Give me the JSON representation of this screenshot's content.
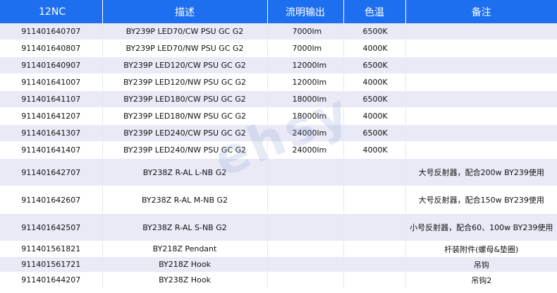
{
  "table": {
    "headers": [
      "12NC",
      "描述",
      "流明输出",
      "色温",
      "备注"
    ],
    "rows": [
      {
        "nc": "911401640707",
        "desc": "BY239P LED70/CW PSU GC G2",
        "flux": "7000lm",
        "cct": "6500K",
        "note": ""
      },
      {
        "nc": "911401640807",
        "desc": "BY239P LED70/NW PSU GC G2",
        "flux": "7000lm",
        "cct": "4000K",
        "note": ""
      },
      {
        "nc": "911401640907",
        "desc": "BY239P LED120/CW PSU GC G2",
        "flux": "12000lm",
        "cct": "6500K",
        "note": ""
      },
      {
        "nc": "911401641007",
        "desc": "BY239P LED120/NW PSU GC G2",
        "flux": "12000lm",
        "cct": "4000K",
        "note": ""
      },
      {
        "nc": "911401641107",
        "desc": "BY239P LED180/CW PSU GC G2",
        "flux": "18000lm",
        "cct": "6500K",
        "note": ""
      },
      {
        "nc": "911401641207",
        "desc": "BY239P LED180/NW PSU GC G2",
        "flux": "18000lm",
        "cct": "4000K",
        "note": ""
      },
      {
        "nc": "911401641307",
        "desc": "BY239P LED240/CW PSU GC G2",
        "flux": "24000lm",
        "cct": "6500K",
        "note": ""
      },
      {
        "nc": "911401641407",
        "desc": "BY239P LED240/NW PSU GC G2",
        "flux": "24000lm",
        "cct": "4000K",
        "note": ""
      },
      {
        "nc": "911401642707",
        "desc": "BY238Z R-AL L-NB G2",
        "flux": "",
        "cct": "",
        "note": "大号反射器，配合200w BY239使用"
      },
      {
        "nc": "911401642607",
        "desc": "BY238Z R-AL M-NB G2",
        "flux": "",
        "cct": "",
        "note": "大号反射器，配合150w BY239使用"
      },
      {
        "nc": "911401642507",
        "desc": "BY238Z R-AL S-NB G2",
        "flux": "",
        "cct": "",
        "note": "小号反射器，配合60、100w BY239使用"
      },
      {
        "nc": "911401561821",
        "desc": "BY218Z Pendant",
        "flux": "",
        "cct": "",
        "note": "杆装附件(螺母&垫圈)"
      },
      {
        "nc": "911401561721",
        "desc": "BY218Z Hook",
        "flux": "",
        "cct": "",
        "note": "吊钩"
      },
      {
        "nc": "911401644207",
        "desc": "BY238Z Hook",
        "flux": "",
        "cct": "",
        "note": "吊钩2"
      }
    ]
  },
  "watermark": "ehsy"
}
